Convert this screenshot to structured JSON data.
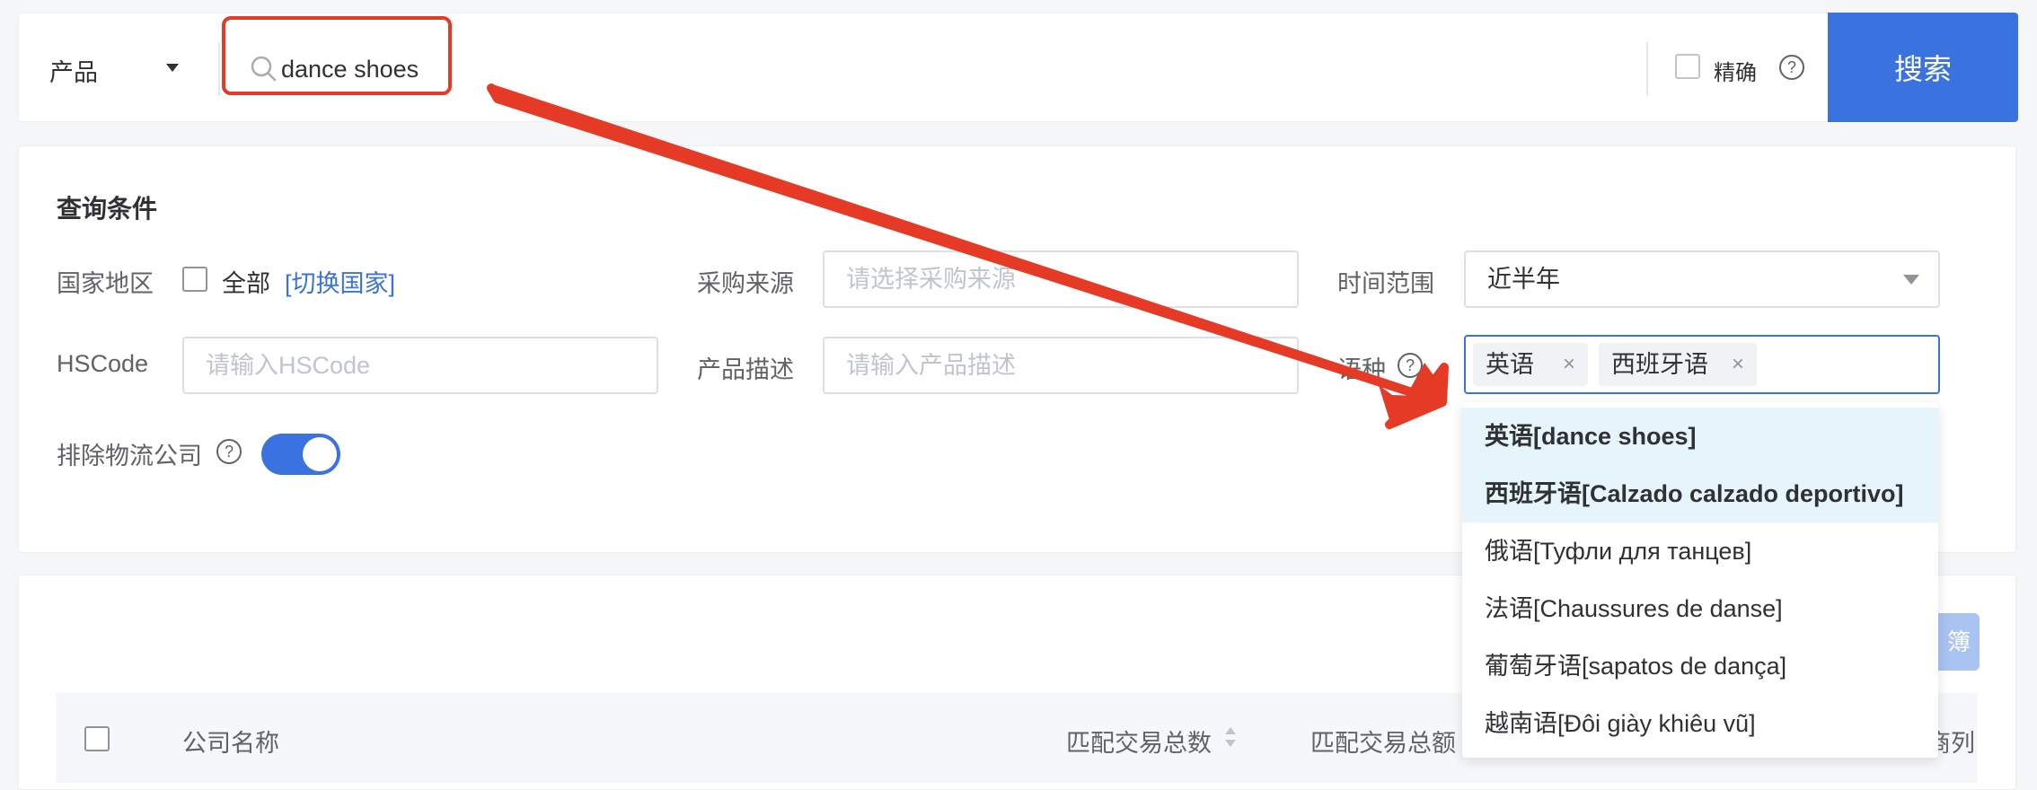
{
  "search": {
    "type_label": "产品",
    "query": "dance shoes",
    "exact_label": "精确",
    "help_glyph": "?",
    "button_label": "搜索"
  },
  "filters": {
    "title": "查询条件",
    "country_label": "国家地区",
    "country_all_label": "全部",
    "country_switch_link": "[切换国家]",
    "source_label": "采购来源",
    "source_placeholder": "请选择采购来源",
    "time_label": "时间范围",
    "time_value": "近半年",
    "hscode_label": "HSCode",
    "hscode_placeholder": "请输入HSCode",
    "desc_label": "产品描述",
    "desc_placeholder": "请输入产品描述",
    "lang_label": "语种",
    "lang_tags": [
      "英语",
      "西班牙语"
    ],
    "tag_close_glyph": "×",
    "exclude_logistics_label": "排除物流公司",
    "exclude_logistics_on": true
  },
  "language_dropdown": {
    "items": [
      {
        "label": "英语[dance shoes]",
        "selected": true
      },
      {
        "label": "西班牙语[Calzado calzado deportivo]",
        "selected": true
      },
      {
        "label": "俄语[Туфли для танцев]",
        "selected": false
      },
      {
        "label": "法语[Chaussures de danse]",
        "selected": false
      },
      {
        "label": "葡萄牙语[sapatos de dança]",
        "selected": false
      },
      {
        "label": "越南语[Đôi giày khiêu vũ]",
        "selected": false
      }
    ]
  },
  "results": {
    "export_label": "簿",
    "columns": [
      "公司名称",
      "匹配交易总数",
      "匹配交易总额",
      "商列"
    ]
  },
  "colors": {
    "accent": "#3a73e0",
    "annotation_red": "#e53a25",
    "selected_row_bg": "#e6f4fb"
  }
}
